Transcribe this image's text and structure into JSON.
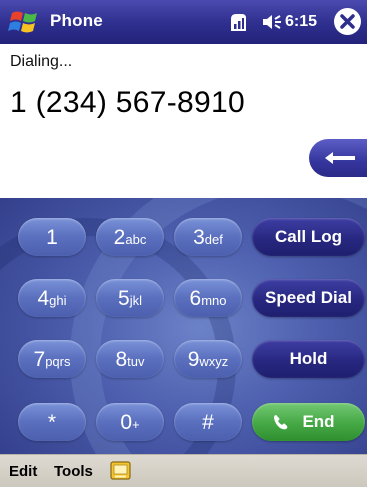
{
  "titlebar": {
    "app_title": "Phone",
    "time": "6:15",
    "icons": [
      "windows-start-icon",
      "signal-icon",
      "speaker-icon",
      "close-icon"
    ]
  },
  "call": {
    "status": "Dialing...",
    "number": "1 (234) 567-8910"
  },
  "keypad": {
    "keys": [
      {
        "digit": "1",
        "letters": ""
      },
      {
        "digit": "2",
        "letters": "abc"
      },
      {
        "digit": "3",
        "letters": "def"
      },
      {
        "digit": "4",
        "letters": "ghi"
      },
      {
        "digit": "5",
        "letters": "jkl"
      },
      {
        "digit": "6",
        "letters": "mno"
      },
      {
        "digit": "7",
        "letters": "pqrs"
      },
      {
        "digit": "8",
        "letters": "tuv"
      },
      {
        "digit": "9",
        "letters": "wxyz"
      },
      {
        "digit": "*",
        "letters": ""
      },
      {
        "digit": "0",
        "letters": "+"
      },
      {
        "digit": "#",
        "letters": ""
      }
    ],
    "functions": {
      "call_log": "Call Log",
      "speed_dial": "Speed Dial",
      "hold": "Hold",
      "end": "End"
    }
  },
  "menubar": {
    "edit": "Edit",
    "tools": "Tools"
  },
  "colors": {
    "titlebar": "#2e2e8e",
    "keypad_bg": "#4d5fae",
    "function_key": "#26267e",
    "end_key": "#44a844",
    "menubar": "#d6d2c8"
  }
}
